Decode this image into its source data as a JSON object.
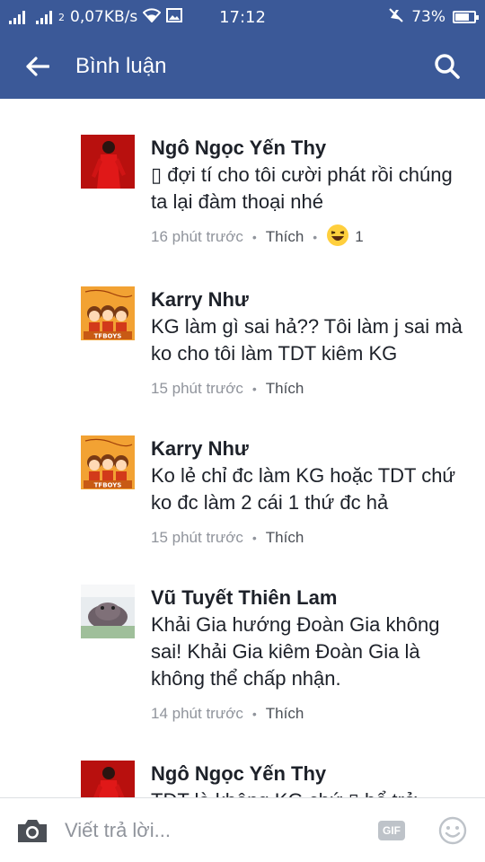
{
  "status_bar": {
    "sim1_tag": "",
    "sim2_tag": "2",
    "network_speed": "0,07KB/s",
    "time": "17:12",
    "battery": "73%",
    "battery_level": 0.73
  },
  "app_bar": {
    "title": "Bình luận",
    "back_icon": "arrow-left-icon",
    "search_icon": "search-icon"
  },
  "comments": [
    {
      "author": "Ngô Ngọc Yến Thy",
      "text": "▯ đợi tí cho tôi cười phát rồi chúng ta lại đàm thoại nhé",
      "time": "16 phút trước",
      "like_label": "Thích",
      "reaction_icon": "haha-emoji-icon",
      "reaction_count": "1",
      "avatar": "red-dress-photo"
    },
    {
      "author": "Karry Như",
      "text": "KG làm gì sai hả?? Tôi làm j sai mà ko cho tôi làm TDT kiêm KG",
      "time": "15 phút trước",
      "like_label": "Thích",
      "avatar": "tfboys-cartoon"
    },
    {
      "author": "Karry Như",
      "text": "Ko lẻ chỉ đc làm KG hoặc TDT chứ ko đc làm 2 cái 1 thứ đc hả",
      "time": "15 phút trước",
      "like_label": "Thích",
      "avatar": "tfboys-cartoon"
    },
    {
      "author": "Vũ Tuyết Thiên Lam",
      "text": "Khải Gia hướng Đoàn Gia không sai! Khải Gia kiêm Đoàn Gia là không thể chấp nhận.",
      "time": "14 phút trước",
      "like_label": "Thích",
      "avatar": "grey-hippo-photo"
    },
    {
      "author": "Ngô Ngọc Yến Thy",
      "text": "TDT là không KG chứ ▯ bổ trở",
      "avatar": "red-dress-photo"
    }
  ],
  "tfboys_logo_text": "TFBOYS",
  "composer": {
    "placeholder": "Viết trả lời...",
    "camera_icon": "camera-icon",
    "gif_label": "GIF",
    "emoji_icon": "smiley-icon"
  },
  "colors": {
    "brand_blue": "#3b5998",
    "text_dark": "#1d2129",
    "meta_gray": "#90949c"
  }
}
